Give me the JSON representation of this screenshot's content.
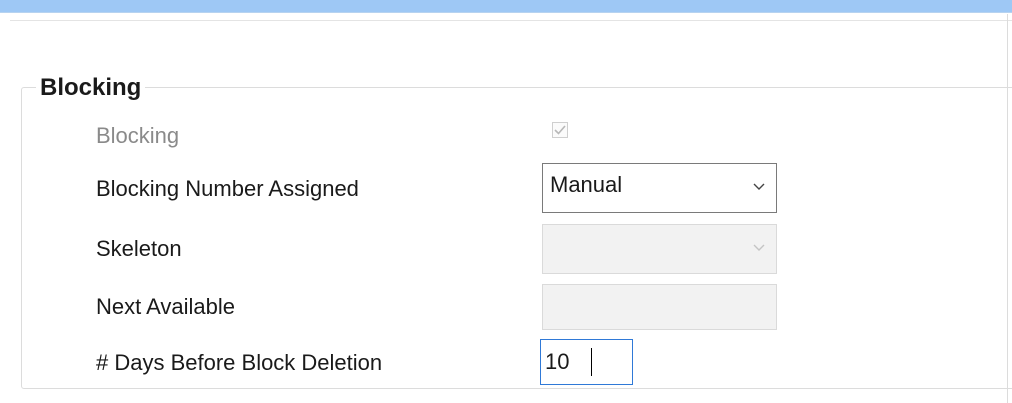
{
  "group": {
    "title": "Blocking"
  },
  "fields": {
    "blocking": {
      "label": "Blocking",
      "checked": true,
      "enabled": false
    },
    "blocking_number_assigned": {
      "label": "Blocking Number Assigned",
      "value": "Manual"
    },
    "skeleton": {
      "label": "Skeleton",
      "value": ""
    },
    "next_available": {
      "label": "Next Available",
      "value": ""
    },
    "days_before_block_deletion": {
      "label": "# Days Before Block Deletion",
      "value": "10"
    }
  },
  "icons": {
    "checkmark": "checkmark-icon",
    "dropdown": "chevron-down-icon"
  },
  "colors": {
    "title_bar": "#9ec8f5",
    "focus_border": "#2f79d7",
    "disabled_text": "#8a8a8a",
    "disabled_fill": "#f2f2f2"
  }
}
